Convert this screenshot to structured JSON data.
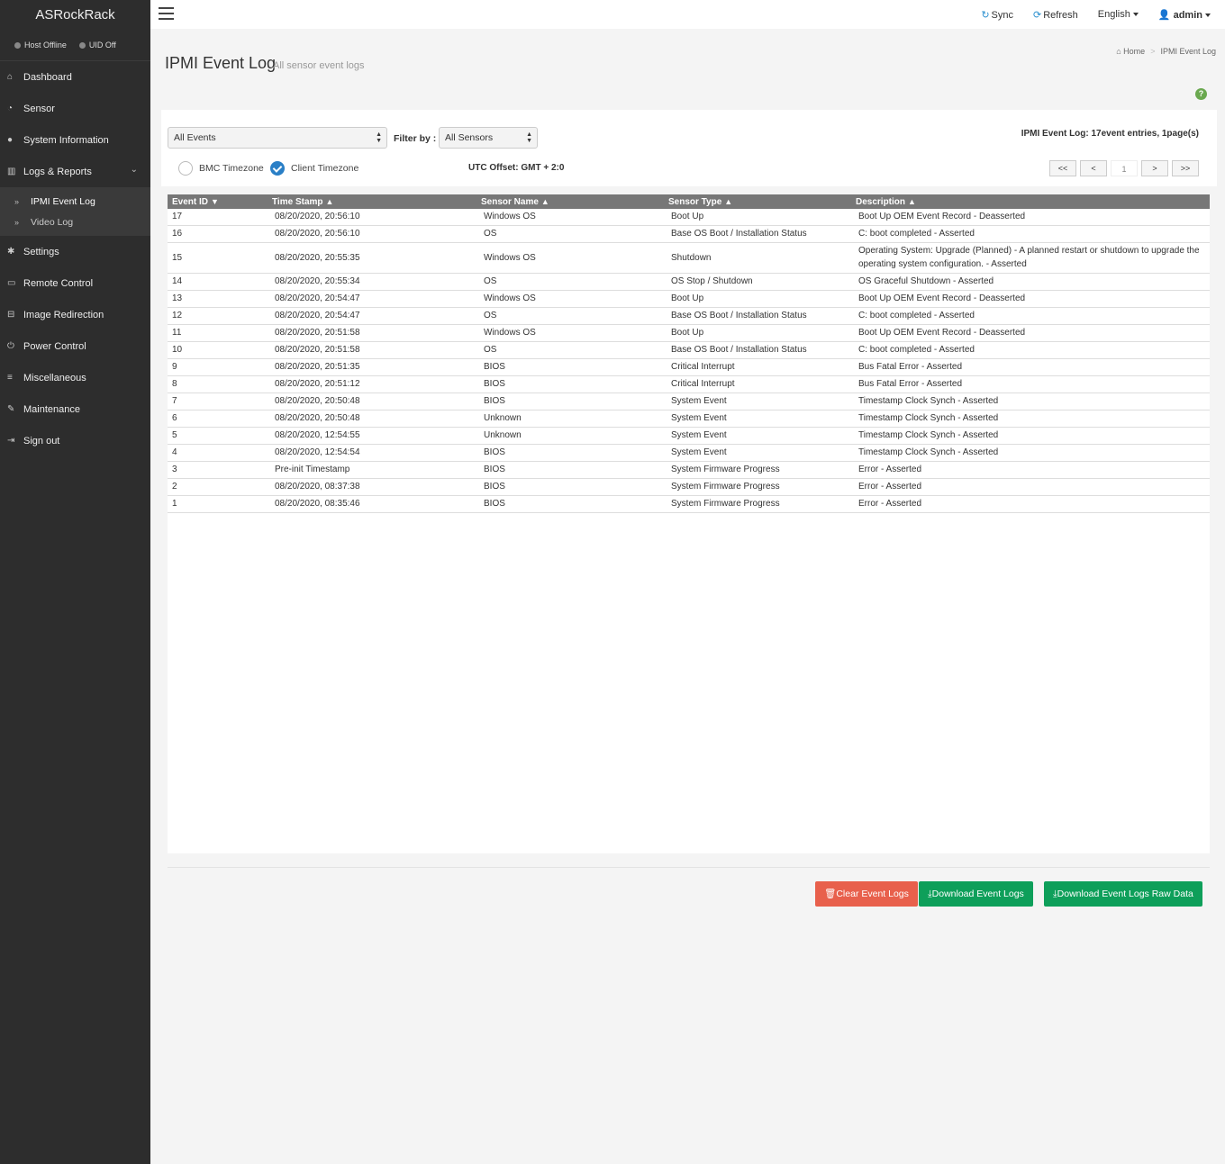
{
  "brand": "ASRockRack",
  "status": {
    "host": "Host Offline",
    "uid": "UID Off"
  },
  "nav": {
    "items": [
      {
        "label": "Dashboard",
        "icon": "home-icon"
      },
      {
        "label": "Sensor",
        "icon": "dashboard-icon"
      },
      {
        "label": "System Information",
        "icon": "info-icon"
      },
      {
        "label": "Logs & Reports",
        "icon": "bar-chart-icon"
      },
      {
        "label": "Settings",
        "icon": "gear-icon"
      },
      {
        "label": "Remote Control",
        "icon": "monitor-icon"
      },
      {
        "label": "Image Redirection",
        "icon": "drive-icon"
      },
      {
        "label": "Power Control",
        "icon": "power-icon"
      },
      {
        "label": "Miscellaneous",
        "icon": "list-icon"
      },
      {
        "label": "Maintenance",
        "icon": "wrench-icon"
      },
      {
        "label": "Sign out",
        "icon": "sign-out-icon"
      }
    ],
    "sub": [
      {
        "label": "IPMI Event Log"
      },
      {
        "label": "Video Log"
      }
    ]
  },
  "topbar": {
    "sync": "Sync",
    "refresh": "Refresh",
    "language": "English",
    "user": "admin"
  },
  "page": {
    "title": "IPMI Event Log",
    "subtitle": "All sensor event logs",
    "breadcrumb": {
      "home": "Home",
      "current": "IPMI Event Log"
    }
  },
  "filters": {
    "events": "All Events",
    "filter_label": "Filter by :",
    "sensors": "All Sensors",
    "bmc_tz": "BMC Timezone",
    "client_tz": "Client Timezone",
    "utc_offset": "UTC Offset: GMT + 2:0",
    "summary": "IPMI Event Log: 17event entries, 1page(s)"
  },
  "pager": {
    "first": "<<",
    "prev": "<",
    "page": "1",
    "next": ">",
    "last": ">>"
  },
  "table": {
    "headers": [
      {
        "label": "Event ID",
        "sort": "▼"
      },
      {
        "label": "Time Stamp",
        "sort": "▲"
      },
      {
        "label": "Sensor Name",
        "sort": "▲"
      },
      {
        "label": "Sensor Type",
        "sort": "▲"
      },
      {
        "label": "Description",
        "sort": "▲"
      }
    ],
    "rows": [
      [
        "17",
        "08/20/2020, 20:56:10",
        "Windows OS",
        "Boot Up",
        "Boot Up OEM Event Record - Deasserted"
      ],
      [
        "16",
        "08/20/2020, 20:56:10",
        "OS",
        "Base OS Boot / Installation Status",
        "C: boot completed - Asserted"
      ],
      [
        "15",
        "08/20/2020, 20:55:35",
        "Windows OS",
        "Shutdown",
        "Operating System: Upgrade (Planned) - A planned restart or shutdown to upgrade the operating system configuration. - Asserted"
      ],
      [
        "14",
        "08/20/2020, 20:55:34",
        "OS",
        "OS Stop / Shutdown",
        "OS Graceful Shutdown - Asserted"
      ],
      [
        "13",
        "08/20/2020, 20:54:47",
        "Windows OS",
        "Boot Up",
        "Boot Up OEM Event Record - Deasserted"
      ],
      [
        "12",
        "08/20/2020, 20:54:47",
        "OS",
        "Base OS Boot / Installation Status",
        "C: boot completed - Asserted"
      ],
      [
        "11",
        "08/20/2020, 20:51:58",
        "Windows OS",
        "Boot Up",
        "Boot Up OEM Event Record - Deasserted"
      ],
      [
        "10",
        "08/20/2020, 20:51:58",
        "OS",
        "Base OS Boot / Installation Status",
        "C: boot completed - Asserted"
      ],
      [
        "9",
        "08/20/2020, 20:51:35",
        "BIOS",
        "Critical Interrupt",
        "Bus Fatal Error - Asserted"
      ],
      [
        "8",
        "08/20/2020, 20:51:12",
        "BIOS",
        "Critical Interrupt",
        "Bus Fatal Error - Asserted"
      ],
      [
        "7",
        "08/20/2020, 20:50:48",
        "BIOS",
        "System Event",
        "Timestamp Clock Synch - Asserted"
      ],
      [
        "6",
        "08/20/2020, 20:50:48",
        "Unknown",
        "System Event",
        "Timestamp Clock Synch - Asserted"
      ],
      [
        "5",
        "08/20/2020, 12:54:55",
        "Unknown",
        "System Event",
        "Timestamp Clock Synch - Asserted"
      ],
      [
        "4",
        "08/20/2020, 12:54:54",
        "BIOS",
        "System Event",
        "Timestamp Clock Synch - Asserted"
      ],
      [
        "3",
        "Pre-init Timestamp",
        "BIOS",
        "System Firmware Progress",
        "Error - Asserted"
      ],
      [
        "2",
        "08/20/2020, 08:37:38",
        "BIOS",
        "System Firmware Progress",
        "Error - Asserted"
      ],
      [
        "1",
        "08/20/2020, 08:35:46",
        "BIOS",
        "System Firmware Progress",
        "Error - Asserted"
      ]
    ]
  },
  "actions": {
    "clear": "Clear Event Logs",
    "download": "Download Event Logs",
    "download_raw": "Download Event Logs Raw Data"
  },
  "colors": {
    "sidebar": "#2d2d2d",
    "accent": "#2a7fc6",
    "danger": "#e8604c",
    "success": "#0e9f5a"
  }
}
